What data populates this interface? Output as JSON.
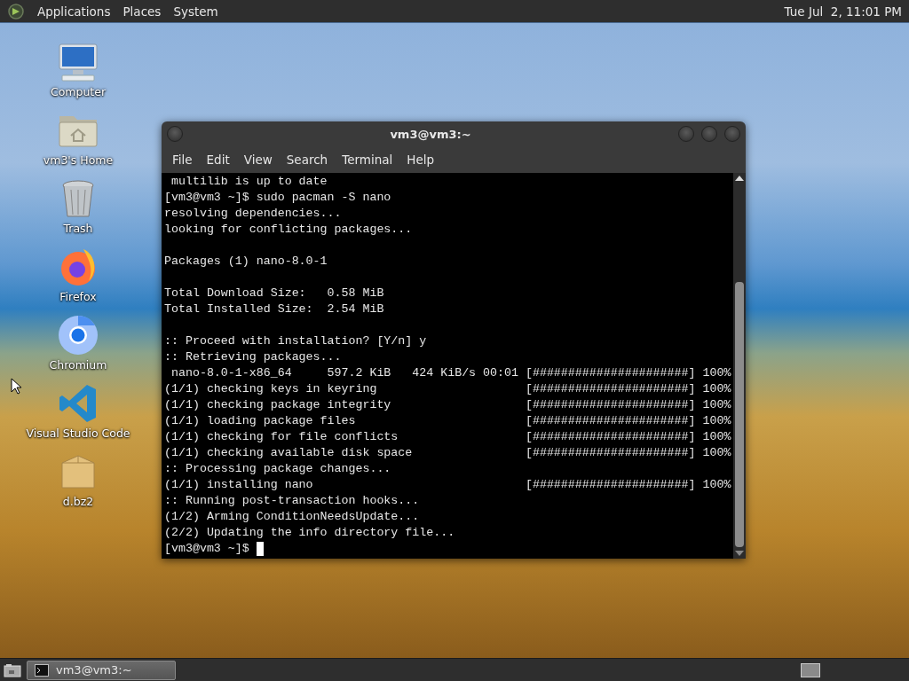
{
  "top_panel": {
    "menus": [
      "Applications",
      "Places",
      "System"
    ],
    "clock": "Tue Jul  2, 11:01 PM"
  },
  "desktop_icons": [
    {
      "label": "Computer",
      "kind": "computer"
    },
    {
      "label": "vm3's Home",
      "kind": "home"
    },
    {
      "label": "Trash",
      "kind": "trash"
    },
    {
      "label": "Firefox",
      "kind": "firefox"
    },
    {
      "label": "Chromium",
      "kind": "chromium"
    },
    {
      "label": "Visual Studio Code",
      "kind": "vscode"
    },
    {
      "label": "d.bz2",
      "kind": "archive"
    }
  ],
  "terminal": {
    "title": "vm3@vm3:~",
    "menu": [
      "File",
      "Edit",
      "View",
      "Search",
      "Terminal",
      "Help"
    ],
    "lines": [
      {
        "kind": "text",
        "text": " multilib is up to date"
      },
      {
        "kind": "text",
        "text": "[vm3@vm3 ~]$ sudo pacman -S nano"
      },
      {
        "kind": "text",
        "text": "resolving dependencies..."
      },
      {
        "kind": "text",
        "text": "looking for conflicting packages..."
      },
      {
        "kind": "blank"
      },
      {
        "kind": "text",
        "text": "Packages (1) nano-8.0-1"
      },
      {
        "kind": "blank"
      },
      {
        "kind": "text",
        "text": "Total Download Size:   0.58 MiB"
      },
      {
        "kind": "text",
        "text": "Total Installed Size:  2.54 MiB"
      },
      {
        "kind": "blank"
      },
      {
        "kind": "text",
        "text": ":: Proceed with installation? [Y/n] y"
      },
      {
        "kind": "text",
        "text": ":: Retrieving packages..."
      },
      {
        "kind": "text",
        "text": " nano-8.0-1-x86_64     597.2 KiB   424 KiB/s 00:01 [######################] 100%"
      },
      {
        "kind": "text",
        "text": "(1/1) checking keys in keyring                     [######################] 100%"
      },
      {
        "kind": "text",
        "text": "(1/1) checking package integrity                   [######################] 100%"
      },
      {
        "kind": "text",
        "text": "(1/1) loading package files                        [######################] 100%"
      },
      {
        "kind": "text",
        "text": "(1/1) checking for file conflicts                  [######################] 100%"
      },
      {
        "kind": "text",
        "text": "(1/1) checking available disk space                [######################] 100%"
      },
      {
        "kind": "text",
        "text": ":: Processing package changes..."
      },
      {
        "kind": "text",
        "text": "(1/1) installing nano                              [######################] 100%"
      },
      {
        "kind": "text",
        "text": ":: Running post-transaction hooks..."
      },
      {
        "kind": "text",
        "text": "(1/2) Arming ConditionNeedsUpdate..."
      },
      {
        "kind": "text",
        "text": "(2/2) Updating the info directory file..."
      }
    ],
    "prompt": "[vm3@vm3 ~]$"
  },
  "taskbar": {
    "tasks": [
      {
        "label": "vm3@vm3:~",
        "selected": true
      }
    ]
  }
}
